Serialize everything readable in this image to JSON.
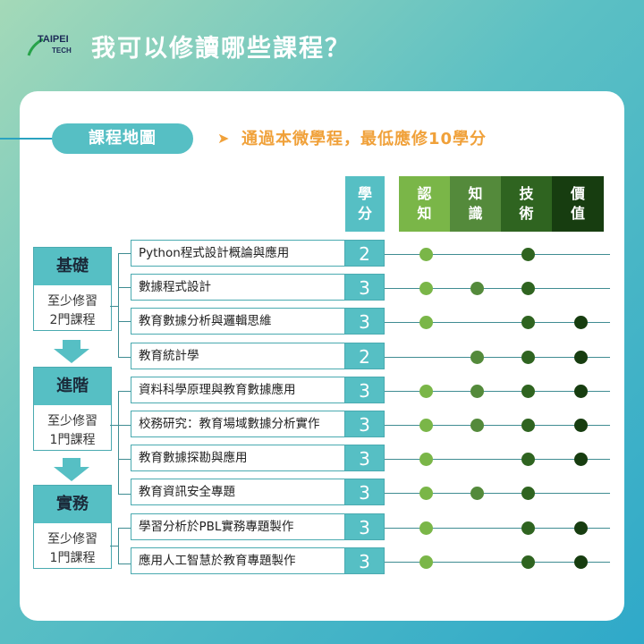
{
  "logo": {
    "line1": "TAIPEI",
    "line2": "TECH"
  },
  "title": "我可以修讀哪些課程？",
  "map_label": "課程地圖",
  "note_arrow": "➤",
  "note": "通過本微學程，最低應修10學分",
  "headers": {
    "credit": [
      "學",
      "分"
    ],
    "cognition": [
      "認",
      "知"
    ],
    "knowledge": [
      "知",
      "識"
    ],
    "skill": [
      "技",
      "術"
    ],
    "value": [
      "價",
      "值"
    ]
  },
  "colors": {
    "cognition": "#7ab648",
    "knowledge": "#548a3b",
    "skill": "#2f6420",
    "value": "#173d10",
    "teal": "#56bfc4"
  },
  "levels": [
    {
      "name": "基礎",
      "req1": "至少修習",
      "req2": "2門課程"
    },
    {
      "name": "進階",
      "req1": "至少修習",
      "req2": "1門課程"
    },
    {
      "name": "實務",
      "req1": "至少修習",
      "req2": "1門課程"
    }
  ],
  "courses": [
    {
      "name": "Python程式設計概論與應用",
      "credits": "2",
      "dots": [
        true,
        false,
        true,
        false
      ]
    },
    {
      "name": "數據程式設計",
      "credits": "3",
      "dots": [
        true,
        true,
        true,
        false
      ]
    },
    {
      "name": "教育數據分析與邏輯思維",
      "credits": "3",
      "dots": [
        true,
        false,
        true,
        true
      ]
    },
    {
      "name": "教育統計學",
      "credits": "2",
      "dots": [
        false,
        true,
        true,
        true
      ]
    },
    {
      "name": "資料科學原理與教育數據應用",
      "credits": "3",
      "dots": [
        true,
        true,
        true,
        true
      ]
    },
    {
      "name": "校務研究：教育場域數據分析實作",
      "credits": "3",
      "dots": [
        true,
        true,
        true,
        true
      ]
    },
    {
      "name": "教育數據探勘與應用",
      "credits": "3",
      "dots": [
        true,
        false,
        true,
        true
      ]
    },
    {
      "name": "教育資訊安全專題",
      "credits": "3",
      "dots": [
        true,
        true,
        true,
        false
      ]
    },
    {
      "name": "學習分析於PBL實務專題製作",
      "credits": "3",
      "dots": [
        true,
        false,
        true,
        true
      ]
    },
    {
      "name": "應用人工智慧於教育專題製作",
      "credits": "3",
      "dots": [
        true,
        false,
        true,
        true
      ]
    }
  ]
}
